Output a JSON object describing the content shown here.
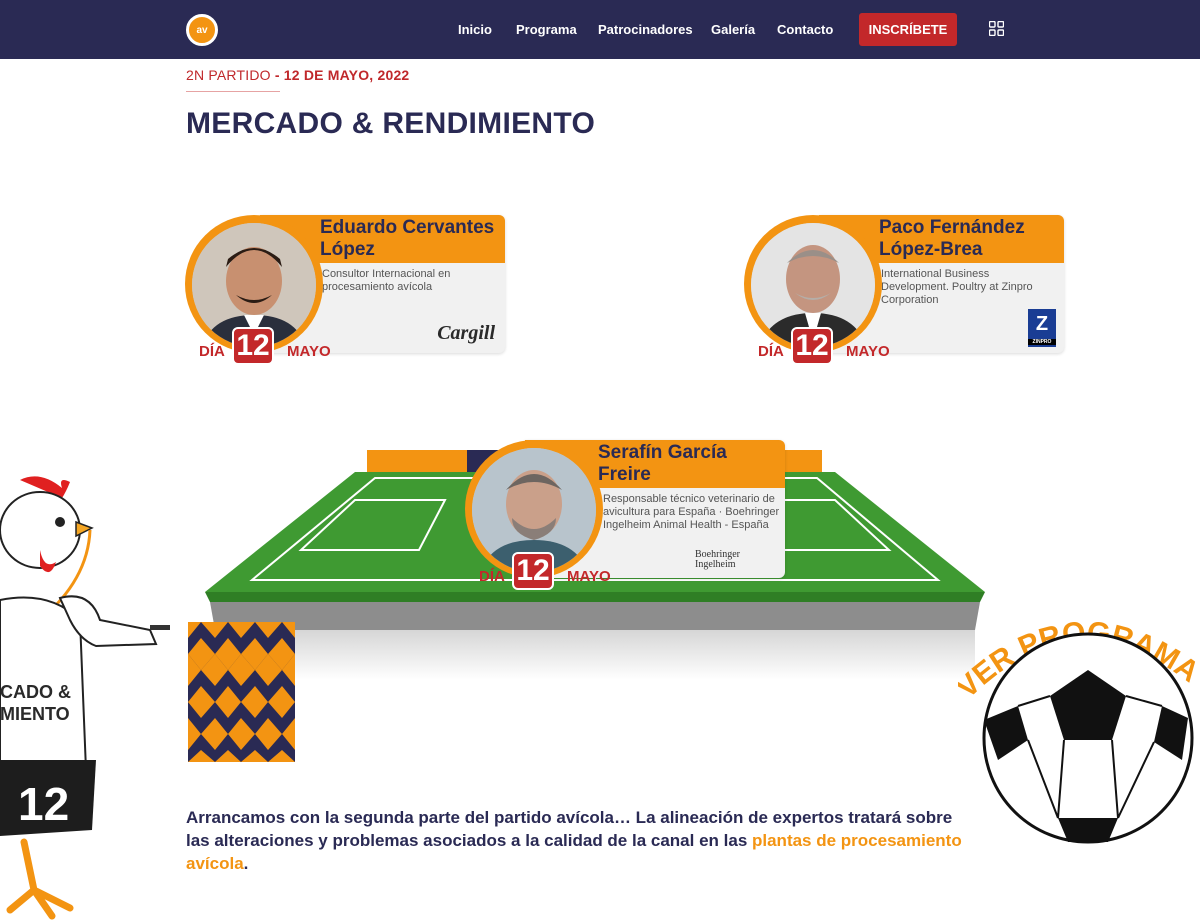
{
  "nav": {
    "logo_text": "av",
    "links": [
      "Inicio",
      "Programa",
      "Patrocinadores",
      "Galería",
      "Contacto"
    ],
    "cta": "INSCRÍBETE"
  },
  "header": {
    "kicker_prefix": "2N PARTIDO",
    "kicker_sep": " - ",
    "kicker_date": "12 DE MAYO, 2022",
    "title": "MERCADO & RENDIMIENTO"
  },
  "speakers": [
    {
      "name": "Eduardo Cervantes López",
      "role": "Consultor Internacional en procesamiento avícola",
      "day_label": "DÍA",
      "day_num": "12",
      "month": "MAYO",
      "sponsor": "Cargill"
    },
    {
      "name": "Paco Fernández López-Brea",
      "role": "International Business Development. Poultry at Zinpro Corporation",
      "day_label": "DÍA",
      "day_num": "12",
      "month": "MAYO",
      "sponsor": "Z",
      "sponsor_sub": "ZINPRO"
    },
    {
      "name": "Serafín García Freire",
      "role": "Responsable técnico veterinario de avicultura para España · Boehringer Ingelheim Animal Health - España",
      "day_label": "DÍA",
      "day_num": "12",
      "month": "MAYO",
      "sponsor": "Boehringer Ingelheim"
    }
  ],
  "mascot": {
    "shirt_text": "CADO & MIENTO",
    "shirt_line1": "CADO &",
    "shirt_line2": "MIENTO",
    "number": "12"
  },
  "ball_cta": "VER PROGRAMA",
  "body": {
    "text_main": "Arrancamos con la segunda parte del partido avícola… La alineación de expertos tratará sobre las alteraciones y problemas asociados a la calidad de la canal en las ",
    "highlight": "plantas de procesamiento avícola",
    "text_end": "."
  },
  "colors": {
    "navy": "#2a2a54",
    "orange": "#f39412",
    "red": "#c3282a",
    "grass": "#3f9a32"
  }
}
